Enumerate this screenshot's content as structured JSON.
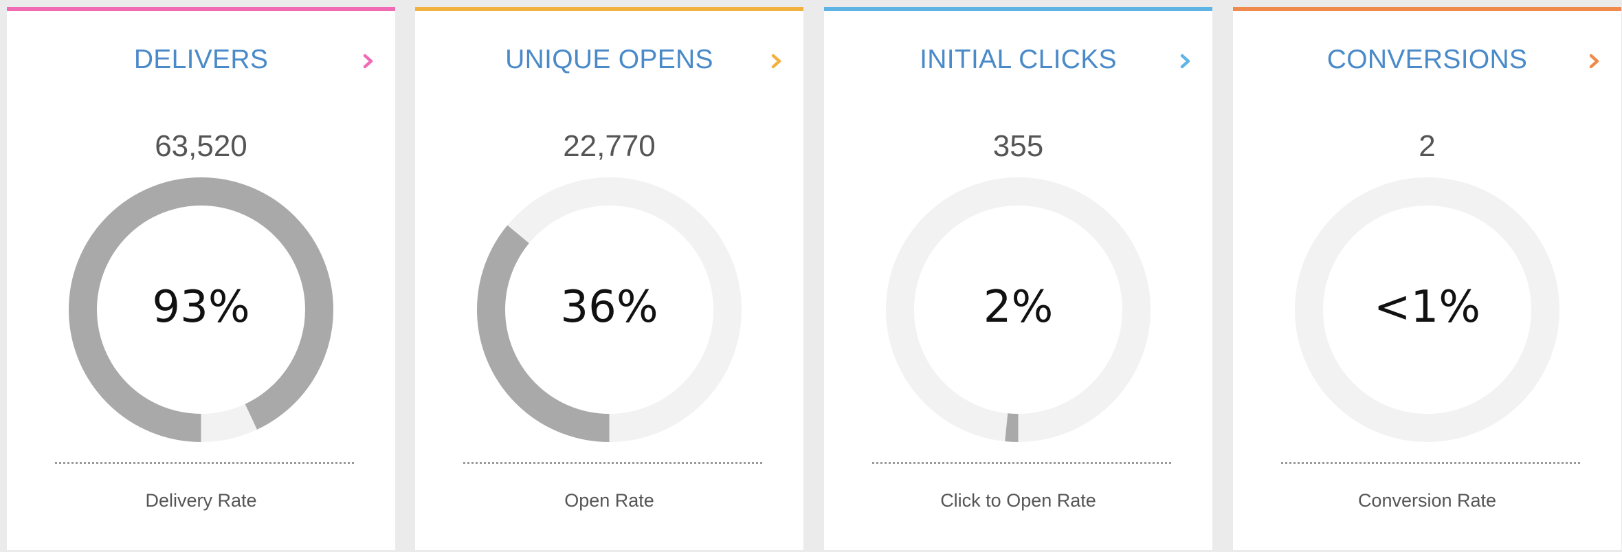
{
  "cards": [
    {
      "title": "DELIVERS",
      "count": "63,520",
      "percent_label": "93%",
      "rate": 0.93,
      "rate_label": "Delivery Rate",
      "accent_color": "#f06ab5",
      "chevron_icon": "chevron-right-icon"
    },
    {
      "title": "UNIQUE OPENS",
      "count": "22,770",
      "percent_label": "36%",
      "rate": 0.36,
      "rate_label": "Open Rate",
      "accent_color": "#f2b13e",
      "chevron_icon": "chevron-right-icon"
    },
    {
      "title": "INITIAL CLICKS",
      "count": "355",
      "percent_label": "2%",
      "rate": 0.016,
      "rate_label": "Click to Open Rate",
      "accent_color": "#5fb4e6",
      "chevron_icon": "chevron-right-icon"
    },
    {
      "title": "CONVERSIONS",
      "count": "2",
      "percent_label": "<1%",
      "rate": 0.0,
      "rate_label": "Conversion Rate",
      "accent_color": "#ef8a4c",
      "chevron_icon": "chevron-right-icon"
    }
  ],
  "ring_colors": {
    "track": "#f2f2f2",
    "fill": "#a9a9a9"
  }
}
